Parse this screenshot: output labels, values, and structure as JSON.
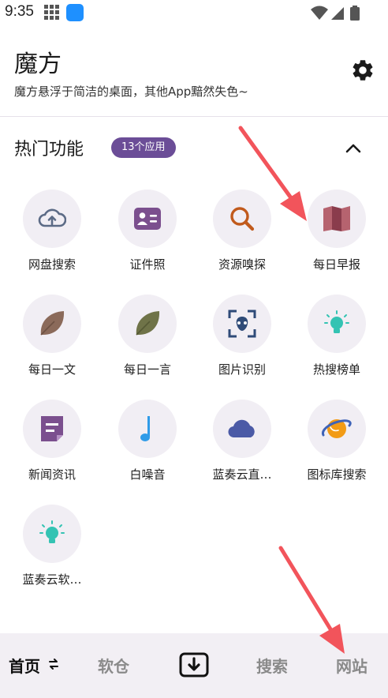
{
  "status_bar": {
    "time": "9:35",
    "icons": [
      "grid-icon",
      "app-notification-icon",
      "wifi-icon",
      "signal-icon",
      "battery-icon"
    ]
  },
  "header": {
    "title": "魔方",
    "subtitle": "魔方悬浮于简洁的桌面，其他App黯然失色~",
    "settings_icon": "gear-icon"
  },
  "section": {
    "title": "热门功能",
    "badge": "13个应用",
    "collapse_icon": "chevron-up-icon"
  },
  "features": [
    {
      "label": "网盘搜索",
      "icon": "cloud-upload-icon"
    },
    {
      "label": "证件照",
      "icon": "id-card-icon"
    },
    {
      "label": "资源嗅探",
      "icon": "magnifier-icon"
    },
    {
      "label": "每日早报",
      "icon": "book-icon"
    },
    {
      "label": "每日一文",
      "icon": "leaf-brown-icon"
    },
    {
      "label": "每日一言",
      "icon": "leaf-olive-icon"
    },
    {
      "label": "图片识别",
      "icon": "scan-icon"
    },
    {
      "label": "热搜榜单",
      "icon": "lightbulb-icon"
    },
    {
      "label": "新闻资讯",
      "icon": "document-icon"
    },
    {
      "label": "白噪音",
      "icon": "music-note-icon"
    },
    {
      "label": "蓝奏云直…",
      "icon": "cloud-icon"
    },
    {
      "label": "图标库搜索",
      "icon": "planet-icon"
    },
    {
      "label": "蓝奏云软…",
      "icon": "lightbulb-teal-icon"
    }
  ],
  "bottom_nav": {
    "home": "首页",
    "software": "软仓",
    "search": "搜索",
    "sites": "网站"
  },
  "colors": {
    "accent": "#6b4d97",
    "icon_bg": "#f1eef4",
    "nav_bg": "#f2eff4",
    "annotation_arrow": "#f2545b"
  }
}
